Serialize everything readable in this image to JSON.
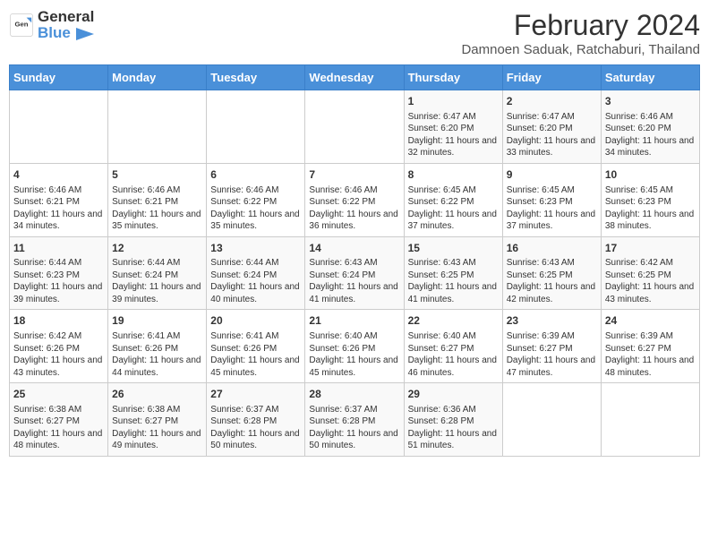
{
  "header": {
    "logo_general": "General",
    "logo_blue": "Blue",
    "title": "February 2024",
    "subtitle": "Damnoen Saduak, Ratchaburi, Thailand"
  },
  "columns": [
    "Sunday",
    "Monday",
    "Tuesday",
    "Wednesday",
    "Thursday",
    "Friday",
    "Saturday"
  ],
  "weeks": [
    [
      {
        "day": "",
        "info": ""
      },
      {
        "day": "",
        "info": ""
      },
      {
        "day": "",
        "info": ""
      },
      {
        "day": "",
        "info": ""
      },
      {
        "day": "1",
        "info": "Sunrise: 6:47 AM\nSunset: 6:20 PM\nDaylight: 11 hours and 32 minutes."
      },
      {
        "day": "2",
        "info": "Sunrise: 6:47 AM\nSunset: 6:20 PM\nDaylight: 11 hours and 33 minutes."
      },
      {
        "day": "3",
        "info": "Sunrise: 6:46 AM\nSunset: 6:20 PM\nDaylight: 11 hours and 34 minutes."
      }
    ],
    [
      {
        "day": "4",
        "info": "Sunrise: 6:46 AM\nSunset: 6:21 PM\nDaylight: 11 hours and 34 minutes."
      },
      {
        "day": "5",
        "info": "Sunrise: 6:46 AM\nSunset: 6:21 PM\nDaylight: 11 hours and 35 minutes."
      },
      {
        "day": "6",
        "info": "Sunrise: 6:46 AM\nSunset: 6:22 PM\nDaylight: 11 hours and 35 minutes."
      },
      {
        "day": "7",
        "info": "Sunrise: 6:46 AM\nSunset: 6:22 PM\nDaylight: 11 hours and 36 minutes."
      },
      {
        "day": "8",
        "info": "Sunrise: 6:45 AM\nSunset: 6:22 PM\nDaylight: 11 hours and 37 minutes."
      },
      {
        "day": "9",
        "info": "Sunrise: 6:45 AM\nSunset: 6:23 PM\nDaylight: 11 hours and 37 minutes."
      },
      {
        "day": "10",
        "info": "Sunrise: 6:45 AM\nSunset: 6:23 PM\nDaylight: 11 hours and 38 minutes."
      }
    ],
    [
      {
        "day": "11",
        "info": "Sunrise: 6:44 AM\nSunset: 6:23 PM\nDaylight: 11 hours and 39 minutes."
      },
      {
        "day": "12",
        "info": "Sunrise: 6:44 AM\nSunset: 6:24 PM\nDaylight: 11 hours and 39 minutes."
      },
      {
        "day": "13",
        "info": "Sunrise: 6:44 AM\nSunset: 6:24 PM\nDaylight: 11 hours and 40 minutes."
      },
      {
        "day": "14",
        "info": "Sunrise: 6:43 AM\nSunset: 6:24 PM\nDaylight: 11 hours and 41 minutes."
      },
      {
        "day": "15",
        "info": "Sunrise: 6:43 AM\nSunset: 6:25 PM\nDaylight: 11 hours and 41 minutes."
      },
      {
        "day": "16",
        "info": "Sunrise: 6:43 AM\nSunset: 6:25 PM\nDaylight: 11 hours and 42 minutes."
      },
      {
        "day": "17",
        "info": "Sunrise: 6:42 AM\nSunset: 6:25 PM\nDaylight: 11 hours and 43 minutes."
      }
    ],
    [
      {
        "day": "18",
        "info": "Sunrise: 6:42 AM\nSunset: 6:26 PM\nDaylight: 11 hours and 43 minutes."
      },
      {
        "day": "19",
        "info": "Sunrise: 6:41 AM\nSunset: 6:26 PM\nDaylight: 11 hours and 44 minutes."
      },
      {
        "day": "20",
        "info": "Sunrise: 6:41 AM\nSunset: 6:26 PM\nDaylight: 11 hours and 45 minutes."
      },
      {
        "day": "21",
        "info": "Sunrise: 6:40 AM\nSunset: 6:26 PM\nDaylight: 11 hours and 45 minutes."
      },
      {
        "day": "22",
        "info": "Sunrise: 6:40 AM\nSunset: 6:27 PM\nDaylight: 11 hours and 46 minutes."
      },
      {
        "day": "23",
        "info": "Sunrise: 6:39 AM\nSunset: 6:27 PM\nDaylight: 11 hours and 47 minutes."
      },
      {
        "day": "24",
        "info": "Sunrise: 6:39 AM\nSunset: 6:27 PM\nDaylight: 11 hours and 48 minutes."
      }
    ],
    [
      {
        "day": "25",
        "info": "Sunrise: 6:38 AM\nSunset: 6:27 PM\nDaylight: 11 hours and 48 minutes."
      },
      {
        "day": "26",
        "info": "Sunrise: 6:38 AM\nSunset: 6:27 PM\nDaylight: 11 hours and 49 minutes."
      },
      {
        "day": "27",
        "info": "Sunrise: 6:37 AM\nSunset: 6:28 PM\nDaylight: 11 hours and 50 minutes."
      },
      {
        "day": "28",
        "info": "Sunrise: 6:37 AM\nSunset: 6:28 PM\nDaylight: 11 hours and 50 minutes."
      },
      {
        "day": "29",
        "info": "Sunrise: 6:36 AM\nSunset: 6:28 PM\nDaylight: 11 hours and 51 minutes."
      },
      {
        "day": "",
        "info": ""
      },
      {
        "day": "",
        "info": ""
      }
    ]
  ]
}
